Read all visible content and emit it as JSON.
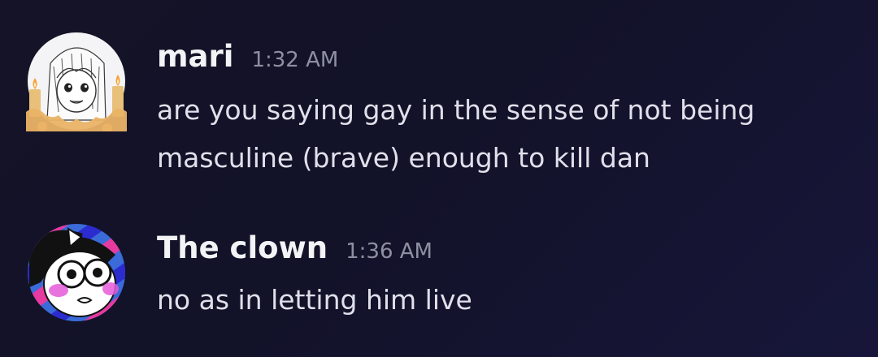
{
  "messages": [
    {
      "username": "mari",
      "timestamp": "1:32 AM",
      "lines": [
        "are you saying gay in the sense of not being",
        "masculine (brave) enough to kill dan"
      ],
      "avatar_icon": "candle-girl-avatar-icon"
    },
    {
      "username": "The clown",
      "timestamp": "1:36 AM",
      "lines": [
        "no as in letting him live"
      ],
      "avatar_icon": "clown-face-avatar-icon"
    }
  ],
  "colors": {
    "background": "#141327",
    "username": "#f2f3f5",
    "timestamp": "#8e90a2",
    "body_text": "#dfe0ea"
  }
}
